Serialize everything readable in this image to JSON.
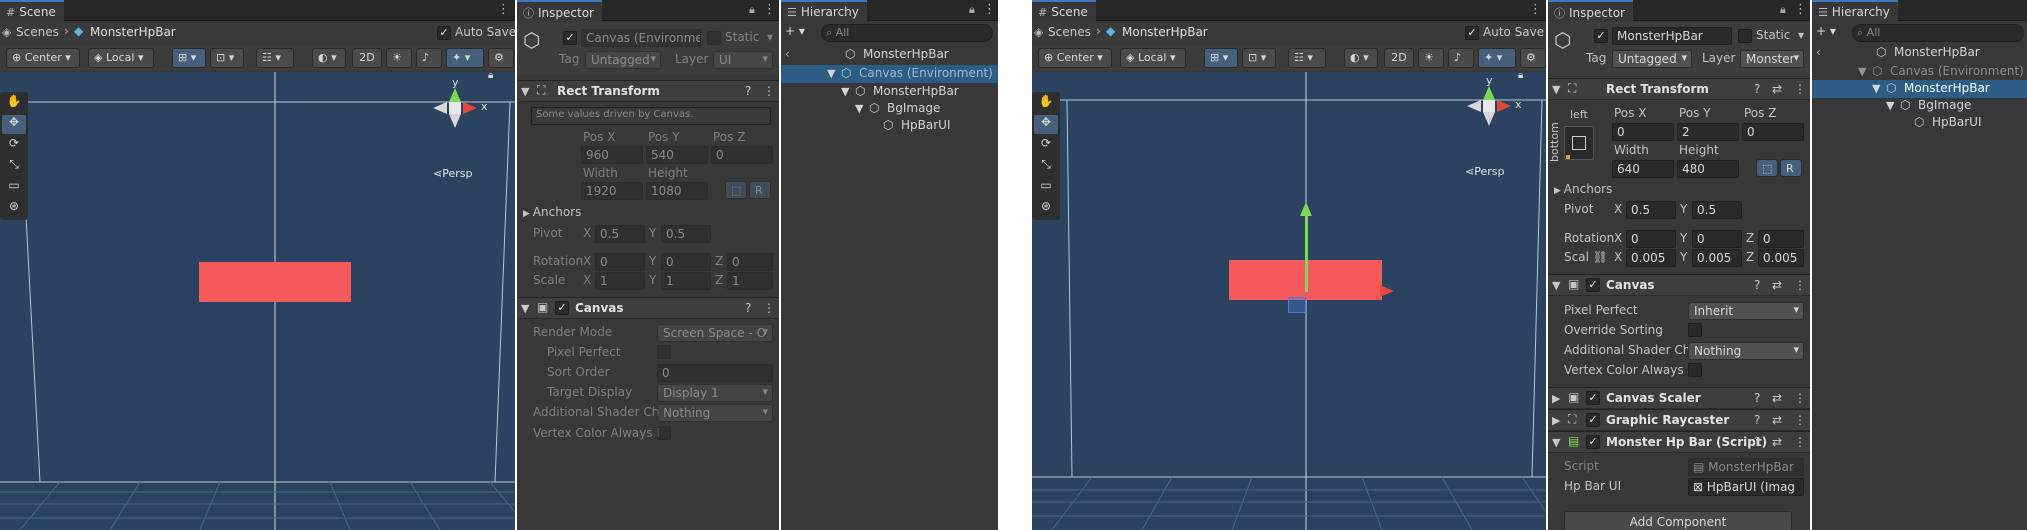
{
  "left": {
    "scene": {
      "tab": "Scene",
      "scenes_label": "Scenes",
      "scene_name": "MonsterHpBar",
      "auto_save": "Auto Save",
      "toolbar": {
        "pivot": "Center",
        "space": "Local",
        "mode2d": "2D"
      },
      "persp": "Persp",
      "gizmo_y": "y",
      "gizmo_x": "x"
    },
    "inspector": {
      "tab": "Inspector",
      "object_name": "Canvas (Environme",
      "static": "Static",
      "tag_label": "Tag",
      "tag_value": "Untagged",
      "layer_label": "Layer",
      "layer_value": "UI",
      "rect": {
        "title": "Rect Transform",
        "note": "Some values driven by Canvas.",
        "posx_label": "Pos X",
        "posy_label": "Pos Y",
        "posz_label": "Pos Z",
        "posx": "960",
        "posy": "540",
        "posz": "0",
        "width_label": "Width",
        "height_label": "Height",
        "width": "1920",
        "height": "1080",
        "r_btn": "R",
        "anchors": "Anchors",
        "pivot_label": "Pivot",
        "pivot_x": "0.5",
        "pivot_y": "0.5",
        "rotation_label": "Rotation",
        "rot_x": "0",
        "rot_y": "0",
        "rot_z": "0",
        "scale_label": "Scale",
        "scale_x": "1",
        "scale_y": "1",
        "scale_z": "1",
        "x": "X",
        "y": "Y",
        "z": "Z"
      },
      "canvas": {
        "title": "Canvas",
        "render_mode_label": "Render Mode",
        "render_mode": "Screen Space - O",
        "pixel_perfect": "Pixel Perfect",
        "sort_order_label": "Sort Order",
        "sort_order": "0",
        "target_display_label": "Target Display",
        "target_display": "Display 1",
        "shader_label": "Additional Shader Ch",
        "shader_value": "Nothing",
        "vertex_label": "Vertex Color Always I"
      }
    },
    "hierarchy": {
      "tab": "Hierarchy",
      "search": "All",
      "items": [
        "MonsterHpBar",
        "Canvas (Environment)",
        "MonsterHpBar",
        "BgImage",
        "HpBarUI"
      ]
    }
  },
  "right": {
    "scene": {
      "tab": "Scene",
      "scenes_label": "Scenes",
      "scene_name": "MonsterHpBar",
      "auto_save": "Auto Save",
      "toolbar": {
        "pivot": "Center",
        "space": "Local",
        "mode2d": "2D"
      },
      "persp": "Persp",
      "gizmo_y": "y",
      "gizmo_x": "x"
    },
    "inspector": {
      "tab": "Inspector",
      "object_name": "MonsterHpBar",
      "static": "Static",
      "tag_label": "Tag",
      "tag_value": "Untagged",
      "layer_label": "Layer",
      "layer_value": "Monster",
      "rect": {
        "title": "Rect Transform",
        "anchor_left": "left",
        "anchor_bottom": "bottom",
        "posx_label": "Pos X",
        "posy_label": "Pos Y",
        "posz_label": "Pos Z",
        "posx": "0",
        "posy": "2",
        "posz": "0",
        "width_label": "Width",
        "height_label": "Height",
        "width": "640",
        "height": "480",
        "r_btn": "R",
        "anchors": "Anchors",
        "pivot_label": "Pivot",
        "pivot_x": "0.5",
        "pivot_y": "0.5",
        "rotation_label": "Rotation",
        "rot_x": "0",
        "rot_y": "0",
        "rot_z": "0",
        "scale_label": "Scal",
        "scale_x": "0.005",
        "scale_y": "0.005",
        "scale_z": "0.005",
        "x": "X",
        "y": "Y",
        "z": "Z"
      },
      "canvas": {
        "title": "Canvas",
        "pixel_perfect_label": "Pixel Perfect",
        "pixel_perfect": "Inherit",
        "override_label": "Override Sorting",
        "shader_label": "Additional Shader Ch",
        "shader_value": "Nothing",
        "vertex_label": "Vertex Color Always I"
      },
      "scaler": "Canvas Scaler",
      "raycaster": "Graphic Raycaster",
      "script": {
        "title": "Monster Hp Bar (Script)",
        "script_label": "Script",
        "script_value": "MonsterHpBar",
        "hpbar_label": "Hp Bar UI",
        "hpbar_value": "HpBarUI (Imag"
      },
      "add_component": "Add Component"
    },
    "hierarchy": {
      "tab": "Hierarchy",
      "search": "All",
      "items": [
        "MonsterHpBar",
        "Canvas (Environment)",
        "MonsterHpBar",
        "BgImage",
        "HpBarUI"
      ]
    }
  },
  "colors": {
    "hp_bar": "#f55a5a",
    "scene_bg": "#2b4260",
    "selection": "#2c5d87",
    "accent": "#3a79bb"
  }
}
